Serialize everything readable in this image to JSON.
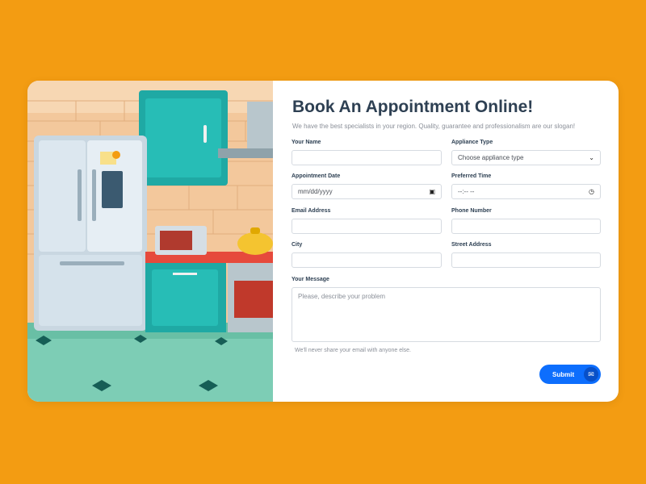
{
  "form": {
    "title": "Book An Appointment Online!",
    "subtitle": "We have the best specialists in your region. Quality, guarantee and professionalism are our slogan!",
    "fields": {
      "your_name": {
        "label": "Your Name",
        "value": ""
      },
      "appliance_type": {
        "label": "Appliance Type",
        "value": "Choose appliance type"
      },
      "appointment_date": {
        "label": "Appointment Date",
        "value": "mm/dd/yyyy"
      },
      "preferred_time": {
        "label": "Preferred Time",
        "value": "--:-- --"
      },
      "email": {
        "label": "Email Address",
        "value": ""
      },
      "phone": {
        "label": "Phone Number",
        "value": ""
      },
      "city": {
        "label": "City",
        "value": ""
      },
      "street": {
        "label": "Street Address",
        "value": ""
      },
      "message": {
        "label": "Your Message",
        "placeholder": "Please, describe your problem"
      }
    },
    "hint": "We'll never share your email with anyone else.",
    "submit_label": "Submit"
  },
  "colors": {
    "background": "#F39C12",
    "title": "#2E4053",
    "button": "#0D6EFD"
  },
  "icons": {
    "select": "chevron-down-icon",
    "date": "calendar-icon",
    "time": "clock-icon",
    "submit": "envelope-icon"
  }
}
